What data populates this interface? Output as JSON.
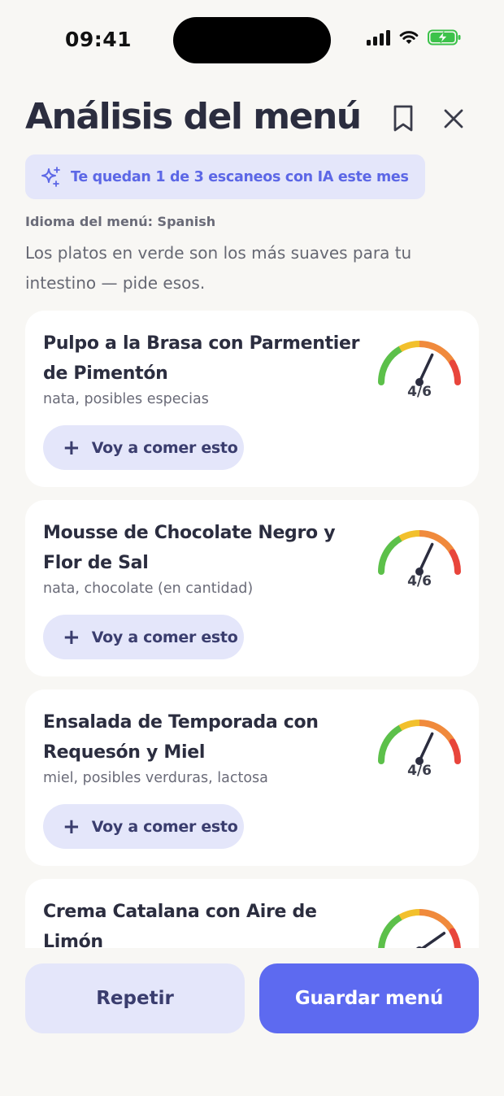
{
  "status_bar": {
    "time": "09:41"
  },
  "header": {
    "title": "Análisis del menú"
  },
  "scan_banner": {
    "text": "Te quedan 1 de 3 escaneos con IA este mes"
  },
  "menu_language": "Idioma del menú: Spanish",
  "hint": "Los platos en verde son los más suaves para tu intestino — pide esos.",
  "dishes": [
    {
      "name": "Pulpo a la Brasa con Parmentier de Pimentón",
      "tags": "nata, posibles especias",
      "score": 4,
      "score_max": 6,
      "score_label": "4/6",
      "button": "Voy a comer esto"
    },
    {
      "name": "Mousse de Chocolate Negro y Flor de Sal",
      "tags": "nata, chocolate (en cantidad)",
      "score": 4,
      "score_max": 6,
      "score_label": "4/6",
      "button": "Voy a comer esto"
    },
    {
      "name": "Ensalada de Temporada con Requesón y Miel",
      "tags": "miel, posibles verduras, lactosa",
      "score": 4,
      "score_max": 6,
      "score_label": "4/6",
      "button": "Voy a comer esto"
    },
    {
      "name": "Crema Catalana con Aire de Limón",
      "tags": "",
      "score": 5,
      "score_max": 6,
      "score_label": "",
      "button": ""
    }
  ],
  "actions": {
    "repeat": "Repetir",
    "save": "Guardar menú"
  },
  "colors": {
    "accent": "#5d6af0",
    "accent_soft": "#e4e6fa",
    "background": "#f8f7f4",
    "gauge_green": "#5cc04a",
    "gauge_yellow": "#f2c02c",
    "gauge_orange": "#f08a3c",
    "gauge_red": "#e8453c"
  },
  "icons": {
    "bookmark": "bookmark-icon",
    "close": "close-icon",
    "sparkle": "sparkle-icon",
    "plus": "plus-icon"
  }
}
